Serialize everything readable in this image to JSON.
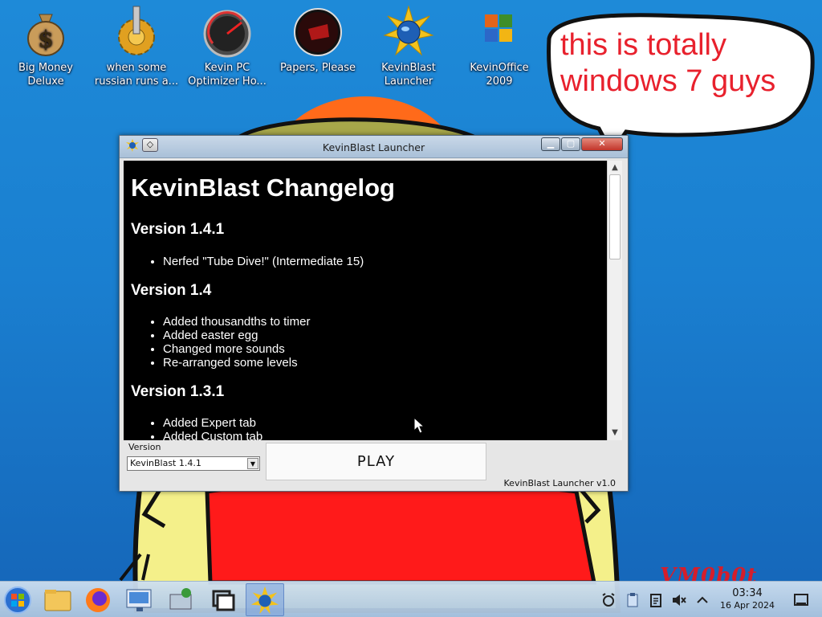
{
  "desktop": {
    "icons": [
      {
        "label": "Big Money\nDeluxe",
        "icon": "money-bag-icon"
      },
      {
        "label": "when some\nrussian runs a...",
        "icon": "gear-icon"
      },
      {
        "label": "Kevin PC\nOptimizer Ho...",
        "icon": "gauge-icon"
      },
      {
        "label": "Papers, Please",
        "icon": "papers-please-icon"
      },
      {
        "label": "KevinBlast\nLauncher",
        "icon": "kevinblast-icon"
      },
      {
        "label": "KevinOffice\n2009",
        "icon": "office-icon"
      }
    ],
    "speech_bubble": "this is totally windows 7 guys",
    "watermark": "VM0b0t"
  },
  "window": {
    "title": "KevinBlast Launcher",
    "pin_glyph": "◇",
    "min_glyph": "▁",
    "max_glyph": "▢",
    "close_glyph": "✕",
    "changelog": {
      "heading": "KevinBlast Changelog",
      "versions": [
        {
          "name": "Version 1.4.1",
          "items": [
            "Nerfed \"Tube Dive!\" (Intermediate 15)"
          ]
        },
        {
          "name": "Version 1.4",
          "items": [
            "Added thousandths to timer",
            "Added easter egg",
            "Changed more sounds",
            "Re-arranged some levels"
          ]
        },
        {
          "name": "Version 1.3.1",
          "items": [
            "Added Expert tab",
            "Added Custom tab"
          ]
        }
      ]
    },
    "version_label": "Version",
    "version_selected": "KevinBlast 1.4.1",
    "play_label": "PLAY",
    "footer": "KevinBlast Launcher v1.0"
  },
  "taskbar": {
    "clock_time": "03:34",
    "clock_date": "16 Apr 2024"
  },
  "colors": {
    "desktop_bg": "#1a7fd0",
    "bubble_text": "#e8212d",
    "changelog_bg": "#000000"
  }
}
